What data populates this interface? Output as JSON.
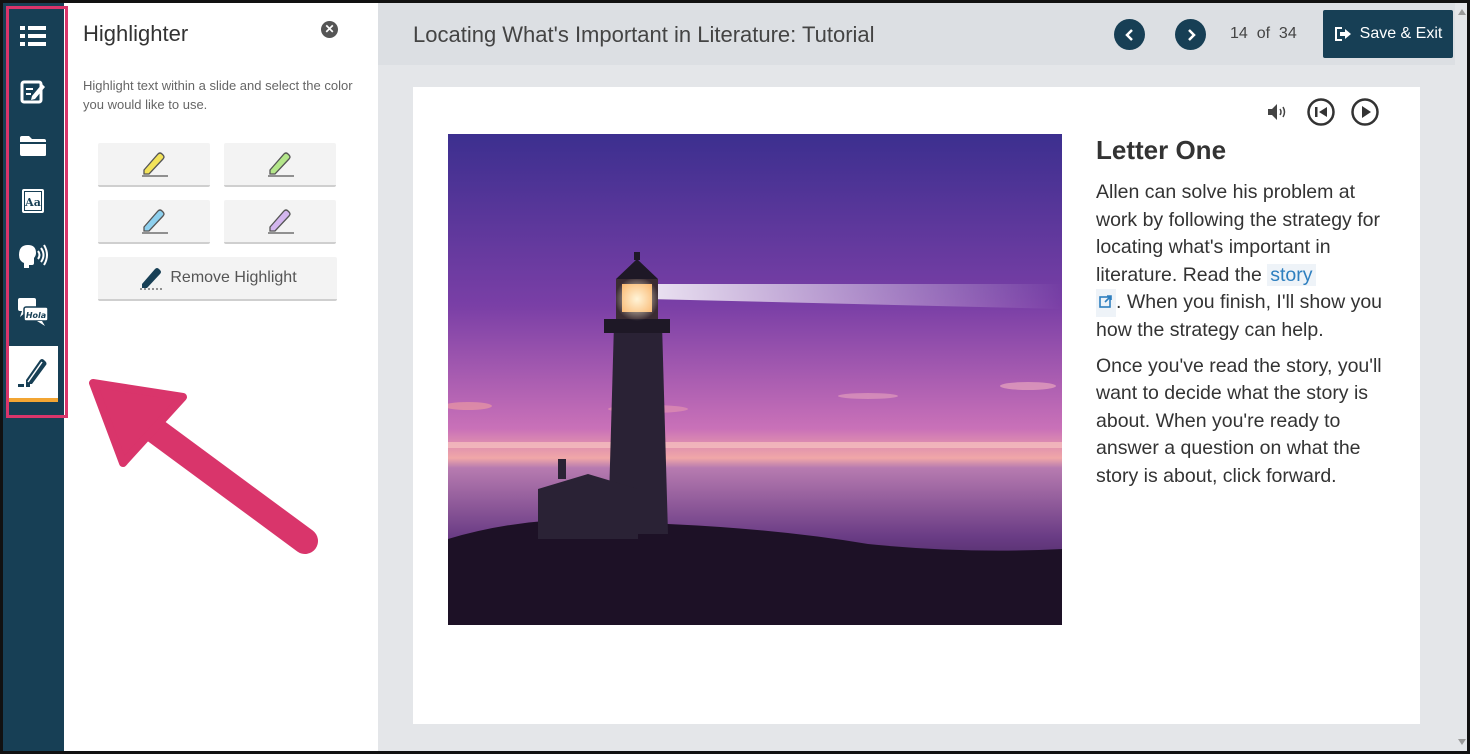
{
  "panel": {
    "title": "Highlighter",
    "description": "Highlight text within a slide and select the color you would like to use.",
    "colors": [
      "#f3e35a",
      "#b4e68a",
      "#8ed0ee",
      "#d3b6ee"
    ],
    "remove_label": "Remove Highlight"
  },
  "rail": {
    "icons": [
      "list-icon",
      "notes-icon",
      "folder-icon",
      "dictionary-icon",
      "text-to-speech-icon",
      "translate-icon",
      "highlighter-icon"
    ],
    "translate_text": "Hola"
  },
  "header": {
    "title": "Locating What's Important in Literature: Tutorial",
    "page_current": "14",
    "page_of": "of",
    "page_total": "34",
    "save_label": "Save & Exit"
  },
  "content": {
    "heading": "Letter One",
    "para1_before": "Allen can solve his problem at work by following the strategy for locating what's important in literature. Read the ",
    "link_text": "story",
    "para1_after": ". When you finish, I'll show you how the strategy can help.",
    "para2": "Once you've read the story, you'll want to decide what the story is about. When you're ready to answer a question on what the story is about, click forward."
  },
  "colors": {
    "rail": "#173f55",
    "annotation": "#d9356b",
    "active_underline": "#f2a533",
    "link": "#2e7fbf"
  }
}
